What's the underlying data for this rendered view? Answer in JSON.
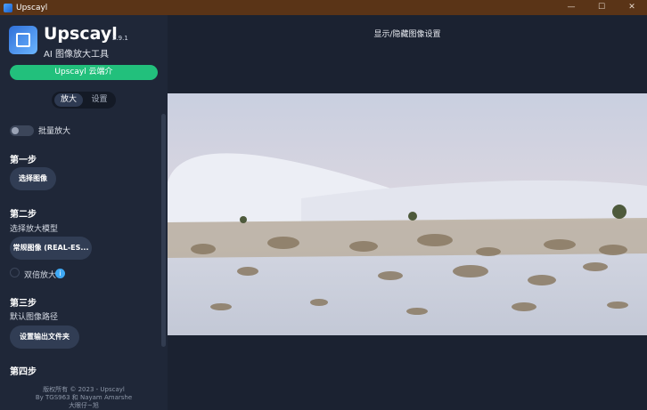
{
  "window": {
    "title": "Upscayl",
    "minimize": "—",
    "maximize": "☐",
    "close": "✕"
  },
  "app": {
    "name": "Upscayl",
    "version": "2.9.1",
    "subtitle": "AI 图像放大工具"
  },
  "intro_button": "Upscayl 云端介",
  "tabs": [
    {
      "label": "放大",
      "active": true
    },
    {
      "label": "设置",
      "active": false
    }
  ],
  "batch_toggle": {
    "label": "批量放大",
    "checked": false
  },
  "steps": {
    "step1": {
      "title": "第一步",
      "button": "选择图像"
    },
    "step2": {
      "title": "第二步",
      "desc": "选择放大模型",
      "button": "常规图像 (REAL-ES...",
      "double_label": "双倍放大",
      "info": "i"
    },
    "step3": {
      "title": "第三步",
      "desc": "默认图像路径",
      "button": "设置输出文件夹"
    },
    "step4": {
      "title": "第四步"
    }
  },
  "footer": {
    "copyright": "版权所有 © 2023 - Upscayl",
    "authors": "By TGS963 和 Nayam Amarshe",
    "extra": "大眼仔~旭"
  },
  "viewer": {
    "hint": "显示/隐藏图像设置"
  },
  "colors": {
    "accent": "#22c07c",
    "titlebar": "#5a3417",
    "sidebar": "#1f2738",
    "info": "#3fa9f5"
  },
  "image_description_icon": "desert-dunes-photo"
}
